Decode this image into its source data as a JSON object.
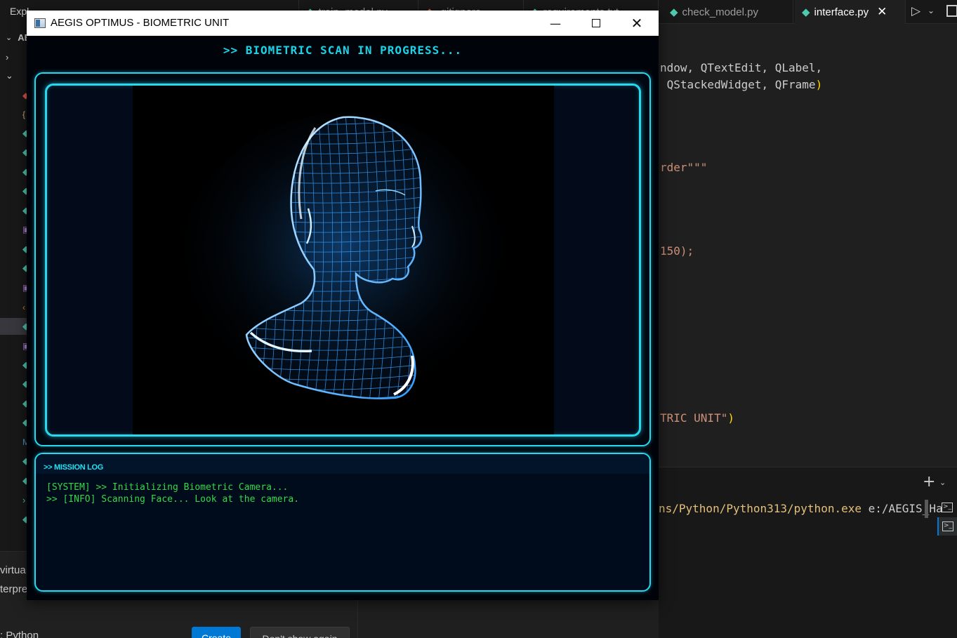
{
  "vscode": {
    "explorer_label": "Expl",
    "explorer_root": "AEG",
    "tabs": [
      {
        "label": "train_model.py",
        "active": false
      },
      {
        "label": ".gitignore",
        "active": false
      },
      {
        "label": "requirements.txt",
        "active": false
      },
      {
        "label": "check_model.py",
        "active": false
      },
      {
        "label": "interface.py",
        "active": true
      }
    ],
    "code_lines": [
      {
        "text": "ndow, QTextEdit, QLabel,"
      },
      {
        "text": " QStackedWidget, QFrame",
        "close": ")"
      },
      {
        "text": "rder\"\"\""
      },
      {
        "text": "150);"
      },
      {
        "text": "TRIC UNIT\"",
        "close": ")"
      }
    ],
    "terminal": {
      "path_text": "ns/Python/Python313/python.exe",
      "arg_text": " e:/AEGIS_Ha"
    },
    "bottom_panel": {
      "line1": "virtua",
      "line2": "terpre",
      "line3": ": Python",
      "create_label": "Create",
      "dont_show_label": "Don't show again"
    },
    "colors": {
      "editor_bg": "#1f1f1f",
      "accent": "#0078d4"
    }
  },
  "window": {
    "title": "AEGIS OPTIMUS - BIOMETRIC UNIT",
    "controls": {
      "minimize": "—",
      "close": "✕"
    },
    "scan_header": ">> BIOMETRIC SCAN IN PROGRESS...",
    "log_title": ">> MISSION LOG",
    "log_lines": [
      "[SYSTEM] >> Initializing Biometric Camera...",
      ">> [INFO] Scanning Face... Look at the camera."
    ],
    "colors": {
      "cyan": "#27d8ef",
      "log_green": "#35d84a",
      "bg": "#00030a"
    }
  }
}
